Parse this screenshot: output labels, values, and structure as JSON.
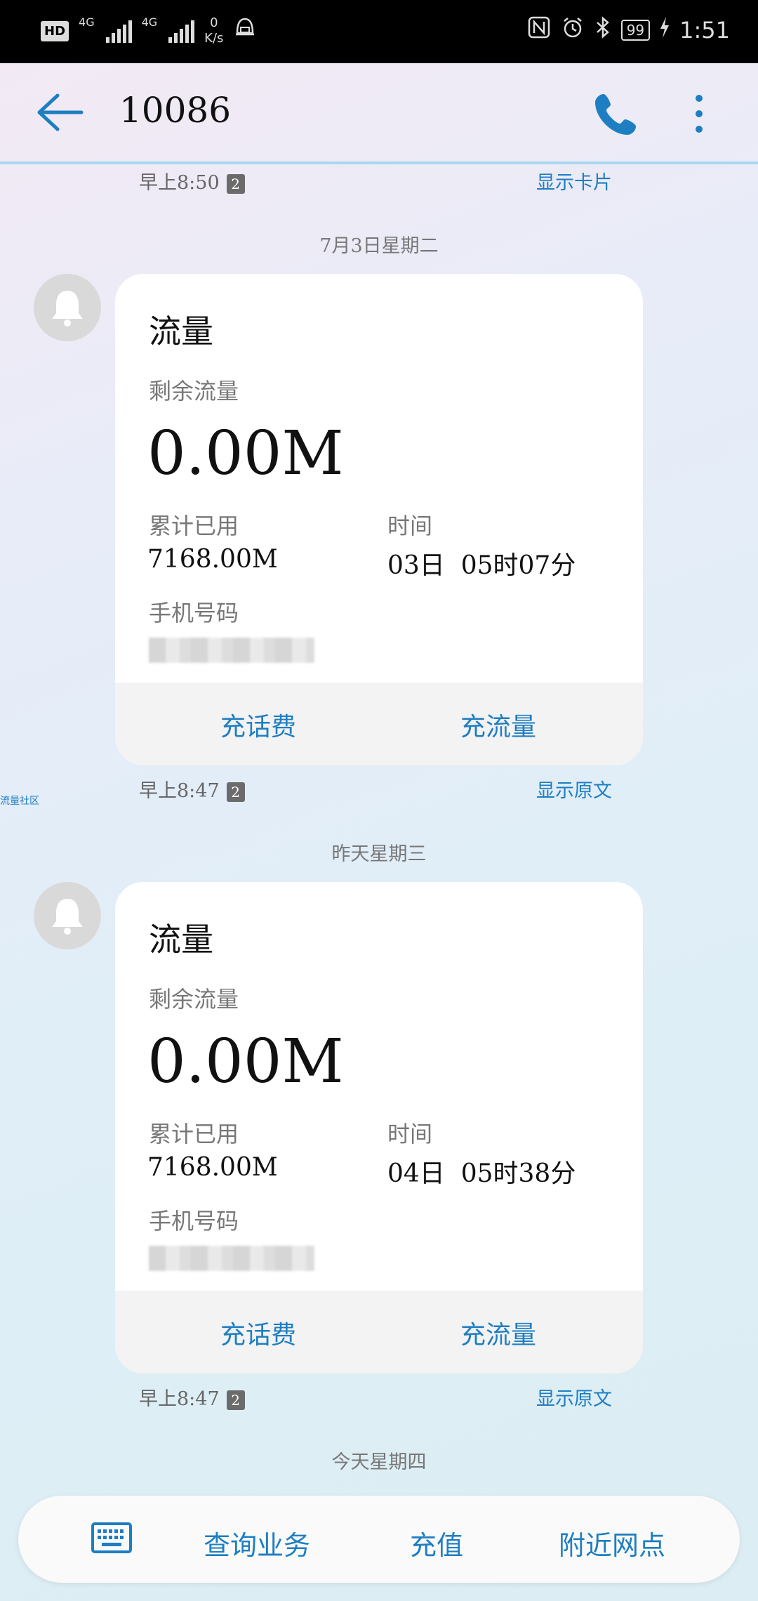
{
  "status_bar": {
    "hd": "HD",
    "net1": "4G",
    "net2": "4G",
    "speed_value": "0",
    "speed_unit": "K/s",
    "battery": "99",
    "time": "1:51"
  },
  "header": {
    "title": "10086"
  },
  "messages": [
    {
      "top_time": "早上8:50",
      "top_badge": "2",
      "top_action": "显示卡片"
    }
  ],
  "day1": "7月3日星期二",
  "card1": {
    "title": "流量",
    "remaining_label": "剩余流量",
    "remaining_value": "0.00M",
    "used_label": "累计已用",
    "used_value": "7168.00M",
    "time_label": "时间",
    "time_value": "03日  05时07分",
    "phone_label": "手机号码",
    "action1": "充话费",
    "action2": "充流量"
  },
  "card1_meta": {
    "time": "早上8:47",
    "badge": "2",
    "action": "显示原文"
  },
  "side_tag": "流量社区",
  "day2": "昨天星期三",
  "card2": {
    "title": "流量",
    "remaining_label": "剩余流量",
    "remaining_value": "0.00M",
    "used_label": "累计已用",
    "used_value": "7168.00M",
    "time_label": "时间",
    "time_value": "04日  05时38分",
    "phone_label": "手机号码",
    "action1": "充话费",
    "action2": "充流量"
  },
  "card2_meta": {
    "time": "早上8:47",
    "badge": "2",
    "action": "显示原文"
  },
  "day3": "今天星期四",
  "bottom_menu": {
    "item1": "查询业务",
    "item2": "充值",
    "item3": "附近网点"
  },
  "colors": {
    "accent": "#1e7ec2",
    "statusbar": "#000000"
  }
}
